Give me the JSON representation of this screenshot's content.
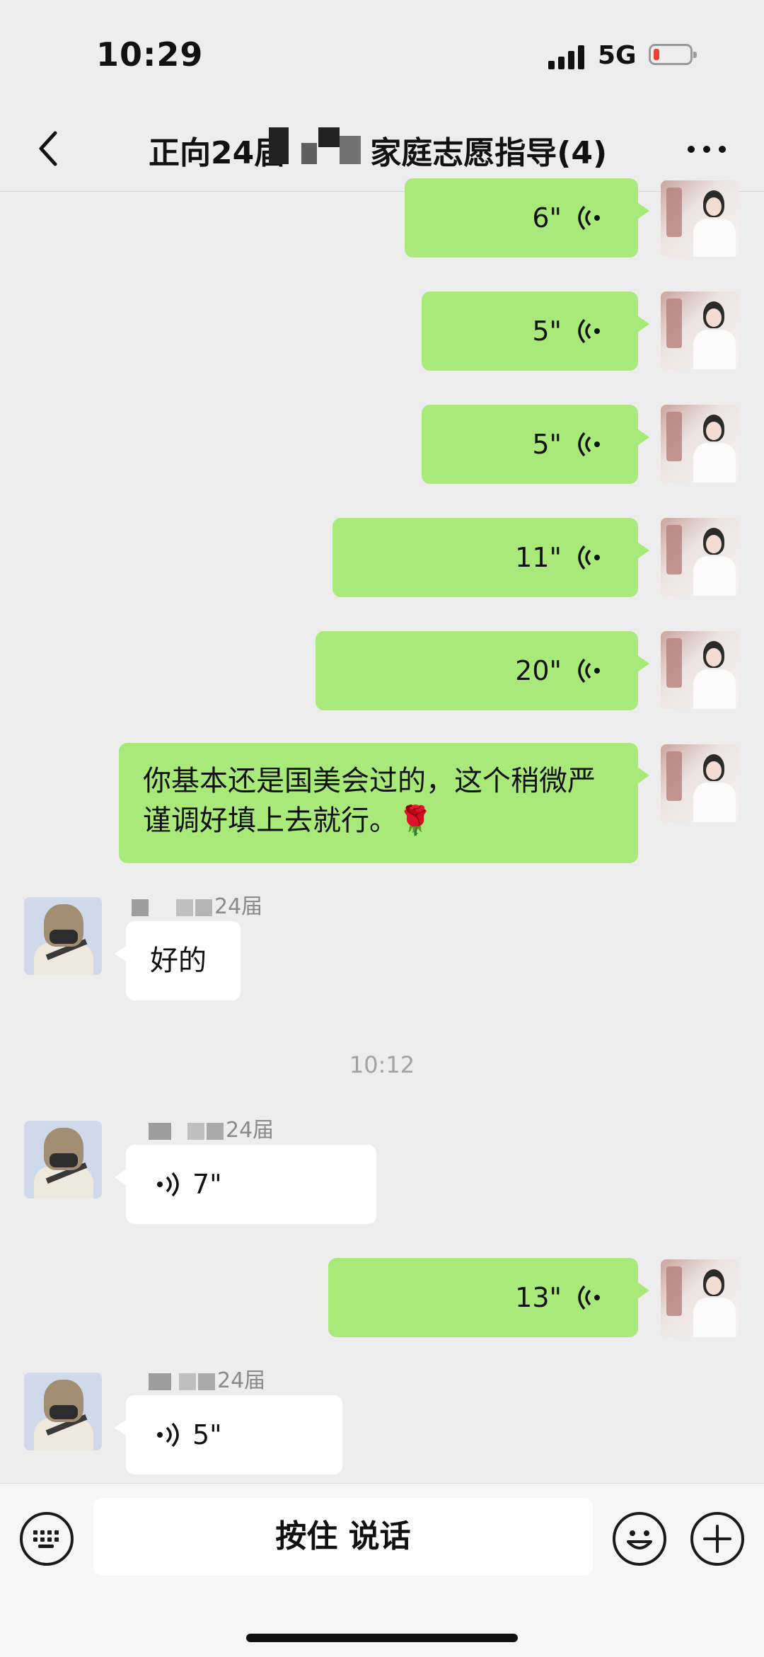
{
  "status_bar": {
    "time": "10:29",
    "network": "5G"
  },
  "nav": {
    "title": "正向24届",
    "title_suffix": "家庭志愿指导(4)"
  },
  "messages": [
    {
      "type": "voice",
      "direction": "out",
      "duration": "6\""
    },
    {
      "type": "voice",
      "direction": "out",
      "duration": "5\""
    },
    {
      "type": "voice",
      "direction": "out",
      "duration": "5\""
    },
    {
      "type": "voice",
      "direction": "out",
      "duration": "11\""
    },
    {
      "type": "voice",
      "direction": "out",
      "duration": "20\""
    },
    {
      "type": "text",
      "direction": "out",
      "text": "你基本还是国美会过的，这个稍微严谨调好填上去就行。🌹"
    },
    {
      "type": "text",
      "direction": "in",
      "sender": "24届",
      "text": "好的"
    },
    {
      "type": "timestamp",
      "text": "10:12"
    },
    {
      "type": "voice",
      "direction": "in",
      "sender": "24届",
      "duration": "7\""
    },
    {
      "type": "voice",
      "direction": "out",
      "duration": "13\""
    },
    {
      "type": "voice",
      "direction": "in",
      "sender": "24届",
      "duration": "5\""
    }
  ],
  "input_bar": {
    "hold_to_talk": "按住 说话"
  }
}
